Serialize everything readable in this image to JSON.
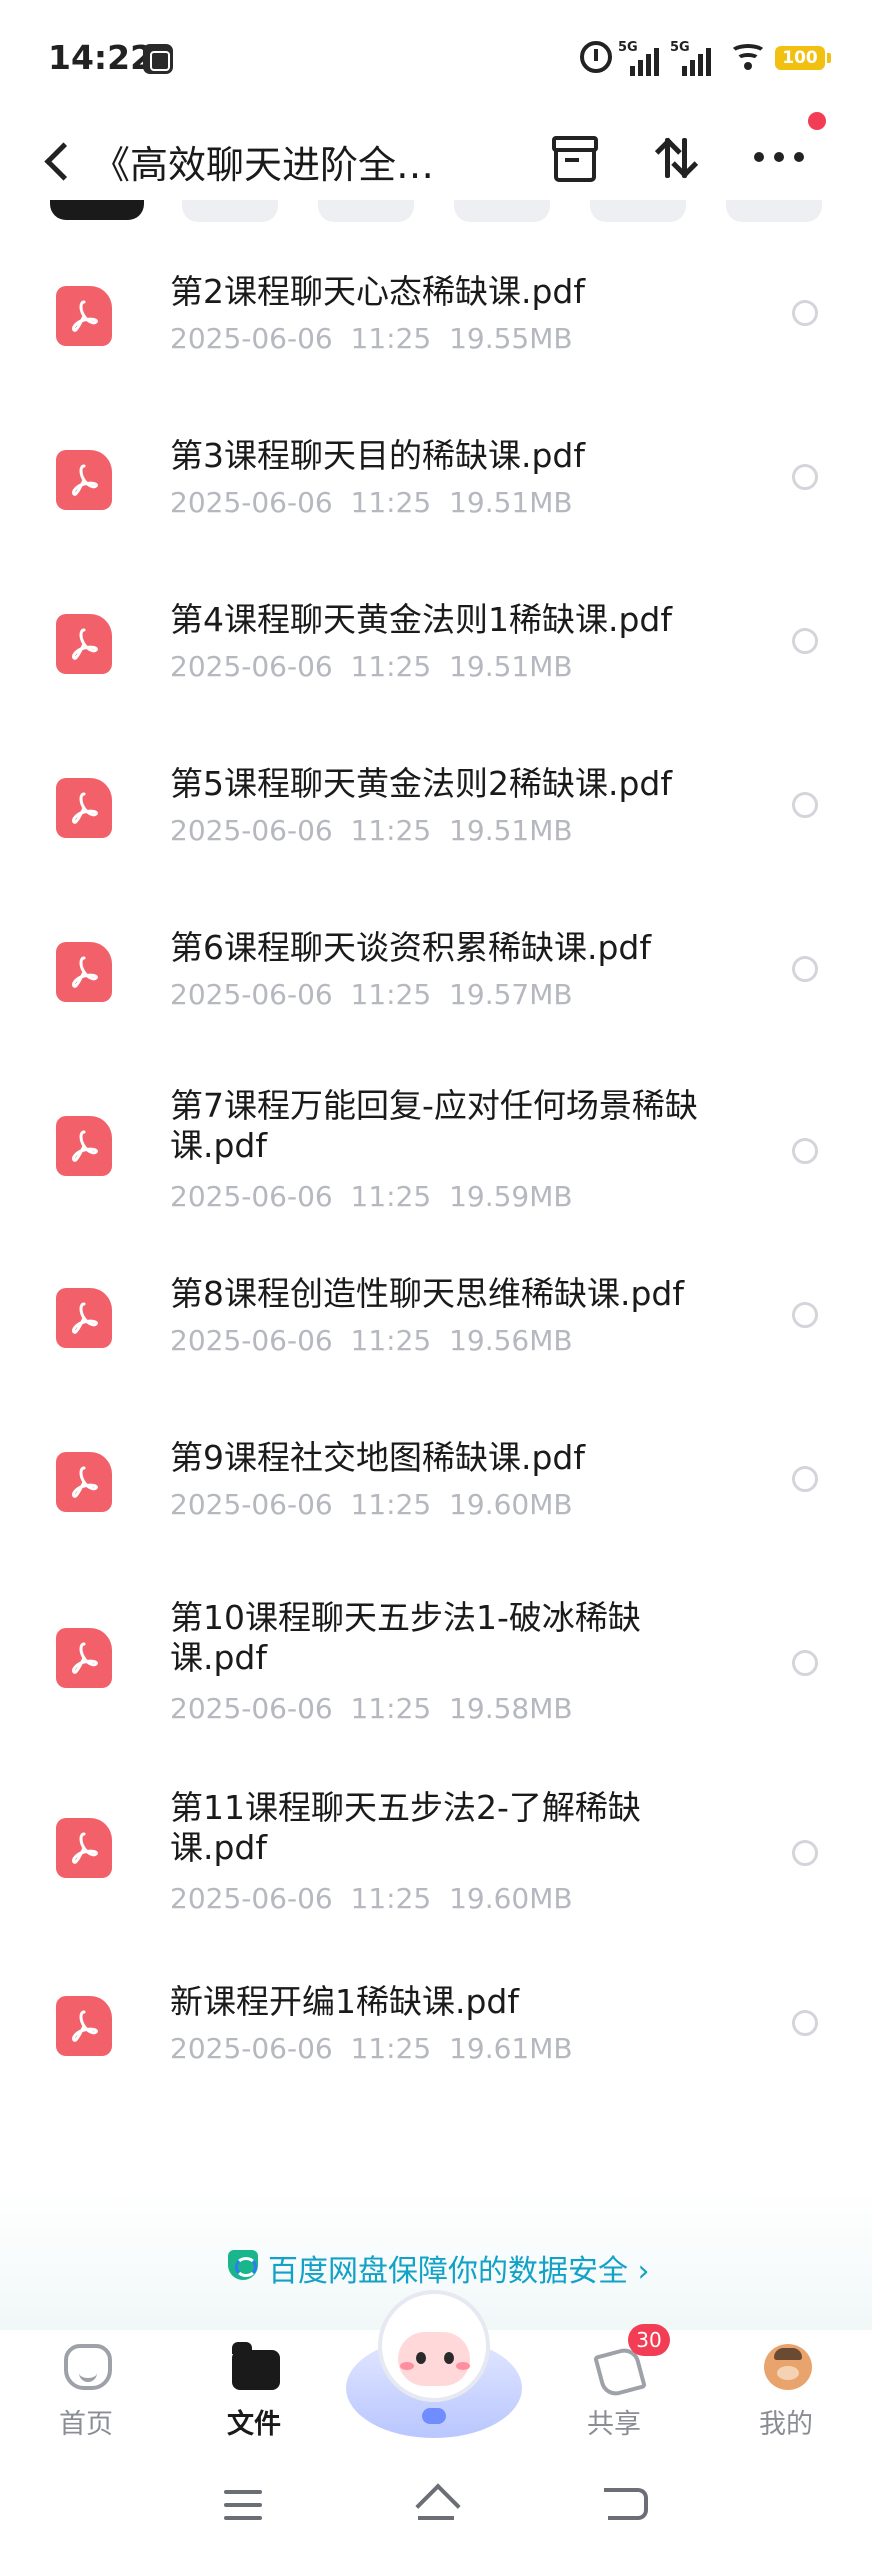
{
  "status_bar": {
    "time": "14:22",
    "signal1": "5G",
    "signal2": "5G",
    "battery": "100"
  },
  "header": {
    "back_icon": "chevron-left-icon",
    "title": "《高效聊天进阶全…",
    "icons": [
      "archive-icon",
      "sort-icon",
      "more-icon"
    ]
  },
  "files": [
    {
      "name": "第2课程聊天心态稀缺课.pdf",
      "date": "2025-06-06",
      "time": "11:25",
      "size": "19.55MB"
    },
    {
      "name": "第3课程聊天目的稀缺课.pdf",
      "date": "2025-06-06",
      "time": "11:25",
      "size": "19.51MB"
    },
    {
      "name": "第4课程聊天黄金法则1稀缺课.pdf",
      "date": "2025-06-06",
      "time": "11:25",
      "size": "19.51MB"
    },
    {
      "name": "第5课程聊天黄金法则2稀缺课.pdf",
      "date": "2025-06-06",
      "time": "11:25",
      "size": "19.51MB"
    },
    {
      "name": "第6课程聊天谈资积累稀缺课.pdf",
      "date": "2025-06-06",
      "time": "11:25",
      "size": "19.57MB"
    },
    {
      "name": "第7课程万能回复-应对任何场景稀缺课.pdf",
      "date": "2025-06-06",
      "time": "11:25",
      "size": "19.59MB"
    },
    {
      "name": "第8课程创造性聊天思维稀缺课.pdf",
      "date": "2025-06-06",
      "time": "11:25",
      "size": "19.56MB"
    },
    {
      "name": "第9课程社交地图稀缺课.pdf",
      "date": "2025-06-06",
      "time": "11:25",
      "size": "19.60MB"
    },
    {
      "name": "第10课程聊天五步法1-破冰稀缺课.pdf",
      "date": "2025-06-06",
      "time": "11:25",
      "size": "19.58MB"
    },
    {
      "name": "第11课程聊天五步法2-了解稀缺课.pdf",
      "date": "2025-06-06",
      "time": "11:25",
      "size": "19.60MB"
    },
    {
      "name": "新课程开编1稀缺课.pdf",
      "date": "2025-06-06",
      "time": "11:25",
      "size": "19.61MB"
    }
  ],
  "security_banner": {
    "text": "百度网盘保障你的数据安全 ›",
    "color": "#12a2c8"
  },
  "tabbar": {
    "home": "首页",
    "files": "文件",
    "share": "共享",
    "share_badge": "30",
    "me": "我的"
  },
  "colors": {
    "pdf": "#f2616a",
    "badge": "#f23d55",
    "accent": "#12a2c8"
  }
}
